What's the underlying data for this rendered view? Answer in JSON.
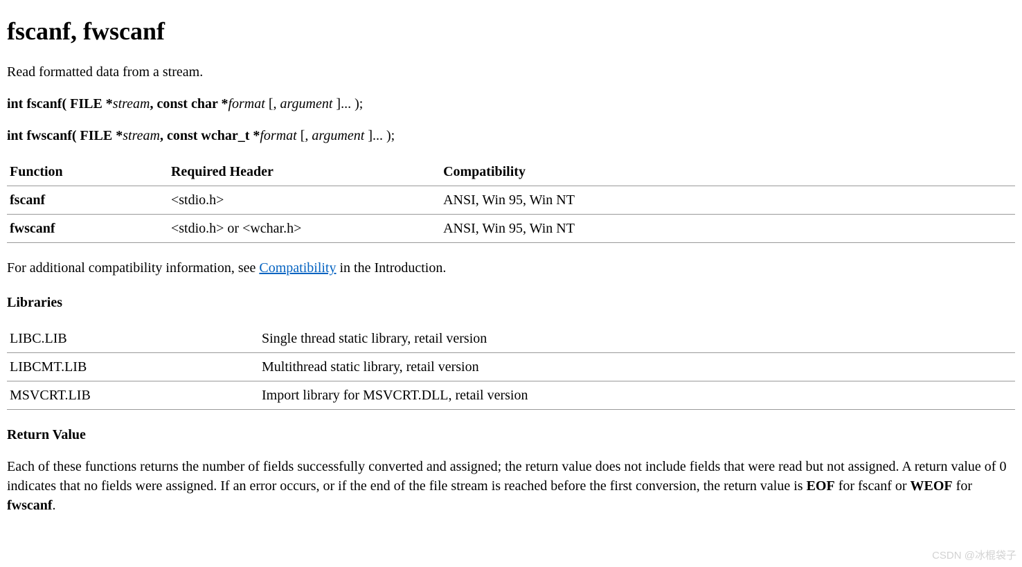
{
  "title": "fscanf, fwscanf",
  "intro": "Read formatted data from a stream.",
  "sig1": {
    "p1": "int fscanf( FILE *",
    "p2": "stream",
    "p3": ", const char *",
    "p4": "format ",
    "p5": "[",
    "p6": ", argument ",
    "p7": "]... );"
  },
  "sig2": {
    "p1": "int fwscanf( FILE *",
    "p2": "stream",
    "p3": ", const wchar_t *",
    "p4": "format ",
    "p5": "[",
    "p6": ", argument ",
    "p7": "]... );"
  },
  "compat_table": {
    "headers": {
      "function": "Function",
      "required_header": "Required Header",
      "compatibility": "Compatibility"
    },
    "rows": [
      {
        "function": "fscanf",
        "required_header": "<stdio.h>",
        "compatibility": "ANSI, Win 95, Win NT"
      },
      {
        "function": "fwscanf",
        "required_header": "<stdio.h> or <wchar.h>",
        "compatibility": "ANSI, Win 95, Win NT"
      }
    ]
  },
  "compat_note": {
    "before": "For additional compatibility information, see ",
    "link": "Compatibility",
    "after": " in the Introduction."
  },
  "libraries_head": "Libraries",
  "libraries": [
    {
      "name": "LIBC.LIB",
      "desc": "Single thread static library, retail version"
    },
    {
      "name": "LIBCMT.LIB",
      "desc": "Multithread static library, retail version"
    },
    {
      "name": "MSVCRT.LIB",
      "desc": "Import library for MSVCRT.DLL, retail version"
    }
  ],
  "return_head": "Return Value",
  "return_value": {
    "t1": "Each of these functions returns the number of fields successfully converted and assigned; the return value does not include fields that were read but not assigned. A return value of 0 indicates that no fields were assigned. If an error occurs, or if the end of the file stream is reached before the first conversion, the return value is ",
    "t2": "EOF",
    "t3": " for fscanf or ",
    "t4": "WEOF",
    "t5": " for ",
    "t6": "fwscanf",
    "t7": "."
  },
  "watermark": "CSDN @冰棍袋子"
}
